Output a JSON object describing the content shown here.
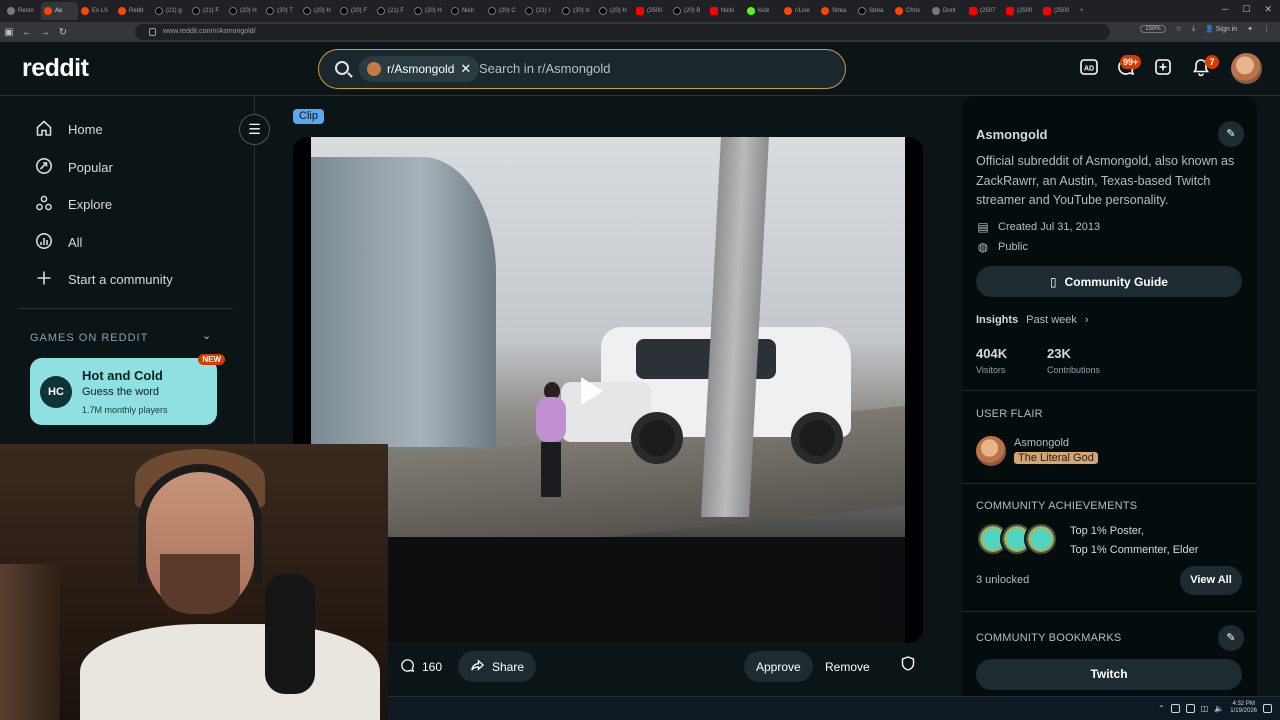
{
  "browser": {
    "tabs": [
      {
        "title": "Resto",
        "icon": "g"
      },
      {
        "title": "As",
        "icon": "r",
        "active": true
      },
      {
        "title": "Ex LS",
        "icon": "r"
      },
      {
        "title": "Redd",
        "icon": "r"
      },
      {
        "title": "(21) g",
        "icon": "x"
      },
      {
        "title": "(21) F",
        "icon": "x"
      },
      {
        "title": "(20) H",
        "icon": "x"
      },
      {
        "title": "(20) T",
        "icon": "x"
      },
      {
        "title": "(20) H",
        "icon": "x"
      },
      {
        "title": "(20) F",
        "icon": "x"
      },
      {
        "title": "(21) F",
        "icon": "x"
      },
      {
        "title": "(20) H",
        "icon": "x"
      },
      {
        "title": "Nish",
        "icon": "x"
      },
      {
        "title": "(20) C",
        "icon": "x"
      },
      {
        "title": "(21) I",
        "icon": "x"
      },
      {
        "title": "(20) Ic",
        "icon": "x"
      },
      {
        "title": "(20) H",
        "icon": "x"
      },
      {
        "title": "(2500",
        "icon": "yt"
      },
      {
        "title": "(20) B",
        "icon": "x"
      },
      {
        "title": "Nicki",
        "icon": "yt"
      },
      {
        "title": "Kick",
        "icon": "k"
      },
      {
        "title": "r/Live",
        "icon": "r"
      },
      {
        "title": "Strea",
        "icon": "r"
      },
      {
        "title": "Strea",
        "icon": "x"
      },
      {
        "title": "Chris",
        "icon": "r"
      },
      {
        "title": "Donl",
        "icon": "g"
      },
      {
        "title": "(2507",
        "icon": "yt"
      },
      {
        "title": "(2500",
        "icon": "yt"
      },
      {
        "title": "(2500",
        "icon": "yt"
      }
    ],
    "url": "www.reddit.com/r/Asmongold/",
    "zoom": "150%",
    "sign_in": "Sign in"
  },
  "header": {
    "logo": "reddit",
    "search_chip": "r/Asmongold",
    "search_placeholder": "Search in r/Asmongold",
    "chat_badge": "99+",
    "notif_badge": "7"
  },
  "sidebar": {
    "items": [
      {
        "label": "Home",
        "icon": "home-icon"
      },
      {
        "label": "Popular",
        "icon": "popular-icon"
      },
      {
        "label": "Explore",
        "icon": "explore-icon"
      },
      {
        "label": "All",
        "icon": "all-icon"
      },
      {
        "label": "Start a community",
        "icon": "plus-icon"
      }
    ],
    "games_title": "GAMES ON REDDIT",
    "game": {
      "title": "Hot and Cold",
      "subtitle": "Guess the word",
      "players": "1.7M monthly players",
      "badge": "NEW",
      "icon_text": "HC"
    }
  },
  "post": {
    "flair": "Clip",
    "comments": "160",
    "share": "Share",
    "approve": "Approve",
    "remove": "Remove"
  },
  "community": {
    "name": "Asmongold",
    "description": "Official subreddit of Asmongold, also known as ZackRawrr, an Austin, Texas-based Twitch streamer and YouTube personality.",
    "created": "Created Jul 31, 2013",
    "visibility": "Public",
    "guide_button": "Community Guide",
    "insights_label": "Insights",
    "insights_period": "Past week",
    "visitors_value": "404K",
    "visitors_label": "Visitors",
    "contributions_value": "23K",
    "contributions_label": "Contributions",
    "user_flair_title": "USER FLAIR",
    "flair_user": "Asmongold",
    "flair_tag": "The Literal God",
    "achievements_title": "COMMUNITY ACHIEVEMENTS",
    "achievements_line1": "Top 1% Poster,",
    "achievements_line2": "Top 1% Commenter, Elder",
    "unlocked": "3 unlocked",
    "view_all": "View All",
    "bookmarks_title": "COMMUNITY BOOKMARKS",
    "bookmark_1": "Twitch"
  },
  "taskbar": {
    "time": "4:32 PM",
    "date": "1/19/2026"
  }
}
